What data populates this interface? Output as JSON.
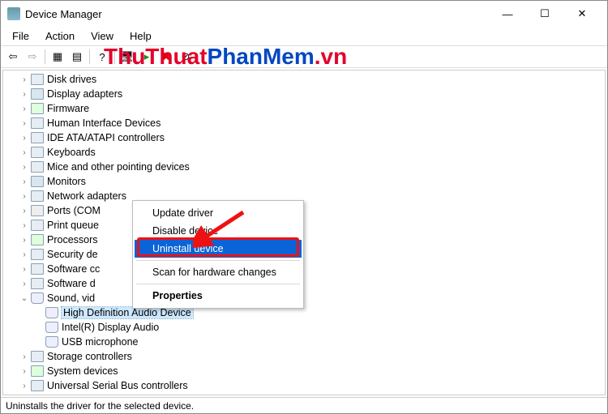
{
  "window": {
    "title": "Device Manager"
  },
  "menus": {
    "file": "File",
    "action": "Action",
    "view": "View",
    "help": "Help"
  },
  "tree": {
    "items": [
      {
        "label": "Disk drives"
      },
      {
        "label": "Display adapters"
      },
      {
        "label": "Firmware"
      },
      {
        "label": "Human Interface Devices"
      },
      {
        "label": "IDE ATA/ATAPI controllers"
      },
      {
        "label": "Keyboards"
      },
      {
        "label": "Mice and other pointing devices"
      },
      {
        "label": "Monitors"
      },
      {
        "label": "Network adapters"
      },
      {
        "label": "Ports (COM"
      },
      {
        "label": "Print queue"
      },
      {
        "label": "Processors"
      },
      {
        "label": "Security de"
      },
      {
        "label": "Software cc"
      },
      {
        "label": "Software d"
      },
      {
        "label": "Sound, vid"
      },
      {
        "label": "Storage controllers"
      },
      {
        "label": "System devices"
      },
      {
        "label": "Universal Serial Bus controllers"
      }
    ],
    "sound_children": [
      {
        "label": "High Definition Audio Device"
      },
      {
        "label": "Intel(R) Display Audio"
      },
      {
        "label": "USB microphone"
      }
    ]
  },
  "context_menu": {
    "update": "Update driver",
    "disable": "Disable device",
    "uninstall": "Uninstall device",
    "scan": "Scan for hardware changes",
    "properties": "Properties"
  },
  "statusbar": {
    "text": "Uninstalls the driver for the selected device."
  },
  "watermark": {
    "part1": "ThuThuat",
    "part2": "PhanMem",
    "part3": ".vn"
  }
}
